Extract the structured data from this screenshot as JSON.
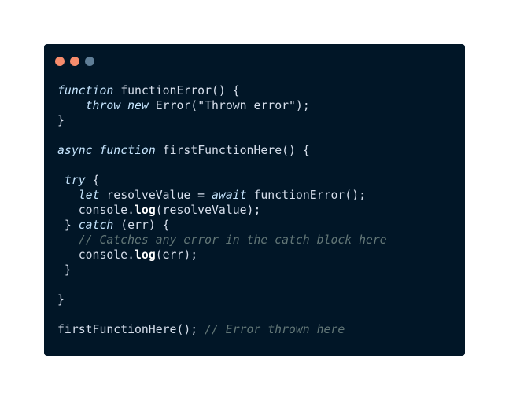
{
  "window": {
    "dots": [
      {
        "name": "close-dot",
        "color": "#f78c6c"
      },
      {
        "name": "minimize-dot",
        "color": "#f78c6c"
      },
      {
        "name": "zoom-dot",
        "color": "#5f7e97"
      }
    ]
  },
  "code": {
    "lines": [
      [
        {
          "t": "function",
          "c": "kw"
        },
        {
          "t": " functionError() {",
          "c": "pn"
        }
      ],
      [
        {
          "t": "    ",
          "c": "pn"
        },
        {
          "t": "throw",
          "c": "kw"
        },
        {
          "t": " ",
          "c": "pn"
        },
        {
          "t": "new",
          "c": "kw"
        },
        {
          "t": " Error(\"Thrown error\");",
          "c": "pn"
        }
      ],
      [
        {
          "t": "}",
          "c": "pn"
        }
      ],
      [
        {
          "t": "",
          "c": "pn"
        }
      ],
      [
        {
          "t": "async",
          "c": "kw"
        },
        {
          "t": " ",
          "c": "pn"
        },
        {
          "t": "function",
          "c": "kw"
        },
        {
          "t": " firstFunctionHere() {",
          "c": "pn"
        }
      ],
      [
        {
          "t": "",
          "c": "pn"
        }
      ],
      [
        {
          "t": " ",
          "c": "pn"
        },
        {
          "t": "try",
          "c": "kw"
        },
        {
          "t": " {",
          "c": "pn"
        }
      ],
      [
        {
          "t": "   ",
          "c": "pn"
        },
        {
          "t": "let",
          "c": "kw"
        },
        {
          "t": " resolveValue = ",
          "c": "pn"
        },
        {
          "t": "await",
          "c": "kw"
        },
        {
          "t": " functionError();",
          "c": "pn"
        }
      ],
      [
        {
          "t": "   console.",
          "c": "pn"
        },
        {
          "t": "log",
          "c": "bold"
        },
        {
          "t": "(resolveValue);",
          "c": "pn"
        }
      ],
      [
        {
          "t": " } ",
          "c": "pn"
        },
        {
          "t": "catch",
          "c": "kw"
        },
        {
          "t": " (err) {",
          "c": "pn"
        }
      ],
      [
        {
          "t": "   ",
          "c": "pn"
        },
        {
          "t": "// Catches any error in the catch block here",
          "c": "cm"
        }
      ],
      [
        {
          "t": "   console.",
          "c": "pn"
        },
        {
          "t": "log",
          "c": "bold"
        },
        {
          "t": "(err);",
          "c": "pn"
        }
      ],
      [
        {
          "t": " }",
          "c": "pn"
        }
      ],
      [
        {
          "t": "",
          "c": "pn"
        }
      ],
      [
        {
          "t": "}",
          "c": "pn"
        }
      ],
      [
        {
          "t": "",
          "c": "pn"
        }
      ],
      [
        {
          "t": "firstFunctionHere(); ",
          "c": "pn"
        },
        {
          "t": "// Error thrown here",
          "c": "cm"
        }
      ]
    ]
  }
}
